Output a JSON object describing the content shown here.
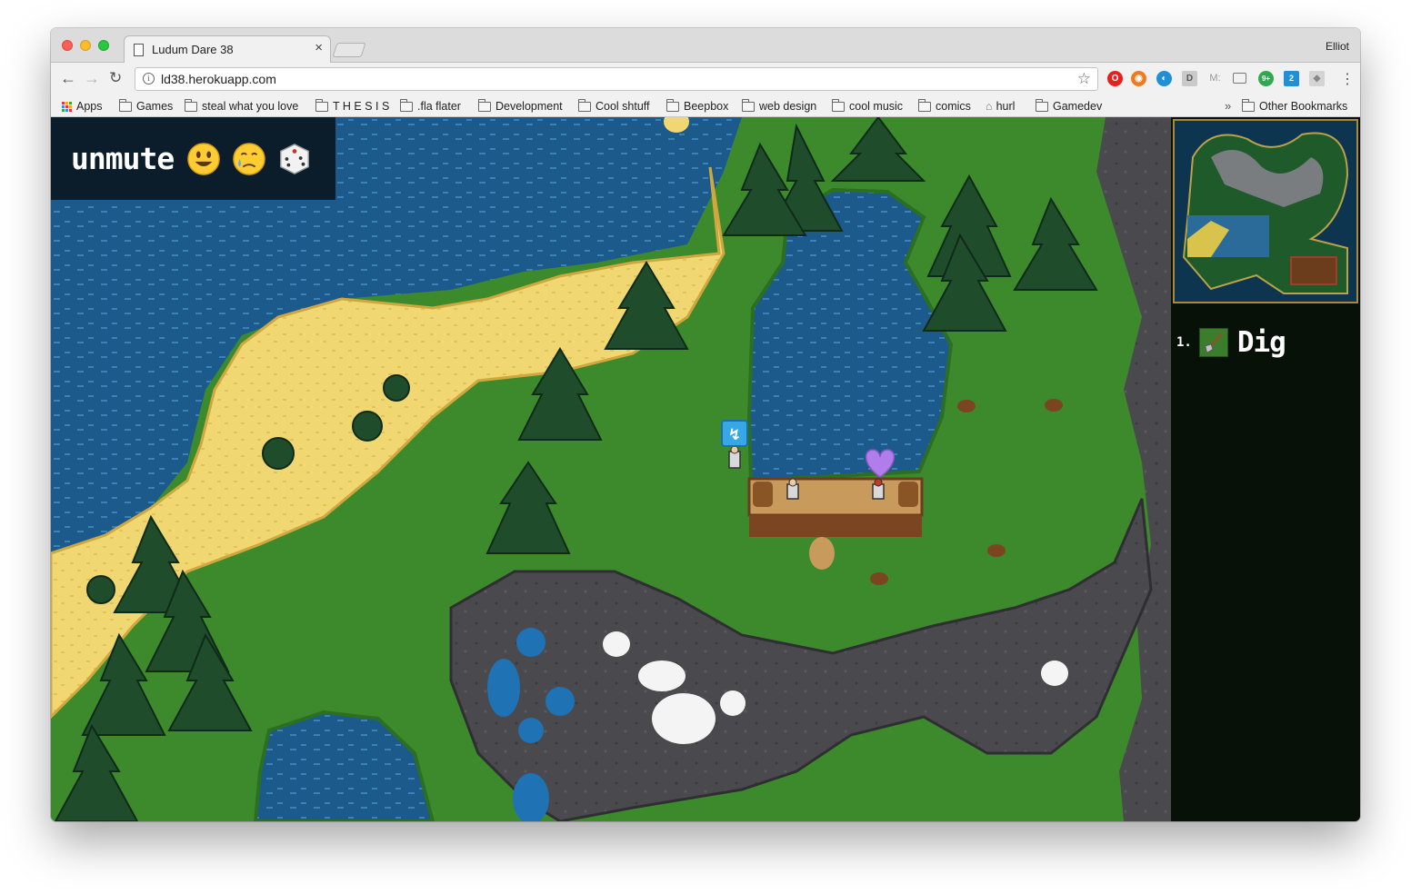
{
  "browser": {
    "tab_title": "Ludum Dare 38",
    "tab_close": "×",
    "profile": "Elliot",
    "url": "ld38.herokuapp.com",
    "nav": {
      "back": "←",
      "forward": "→",
      "reload": "↻"
    },
    "star": "☆",
    "menu": "⋮",
    "extensions": [
      "opera-icon",
      "orange-ext-icon",
      "blue-ext-icon",
      "D",
      "M:",
      "cast-icon",
      "9+",
      "2",
      "puzzle-ext-icon"
    ],
    "extension_colors": {
      "opera": "#e5201d",
      "orange": "#f07b1d",
      "blue": "#1f8fd6",
      "green": "#2fa84f"
    }
  },
  "bookmarks": {
    "items": [
      "Apps",
      "Games",
      "steal what you love",
      "T H E S I S",
      ".fla flater",
      "Development",
      "Cool shtuff",
      "Beepbox",
      "web design",
      "cool music",
      "comics",
      "hurl",
      "Gamedev"
    ],
    "overflow": "»",
    "other": "Other Bookmarks"
  },
  "game": {
    "hud": {
      "unmute_label": "unmute",
      "emotes": [
        "smiley-emoji-icon",
        "crying-emoji-icon",
        "dice-icon"
      ]
    },
    "floating_icons": [
      "speed-buff-icon",
      "heart-icon"
    ],
    "abilities": [
      {
        "number": "1.",
        "label": "Dig",
        "icon": "shovel-icon"
      }
    ],
    "colors": {
      "water": "#1d5a8c",
      "sand": "#f1d772",
      "grass": "#3d8a2c",
      "rock": "#4a4a4e",
      "tree": "#1f4d2c",
      "panel": "#071108",
      "minimap_border": "#a88a3a"
    }
  }
}
